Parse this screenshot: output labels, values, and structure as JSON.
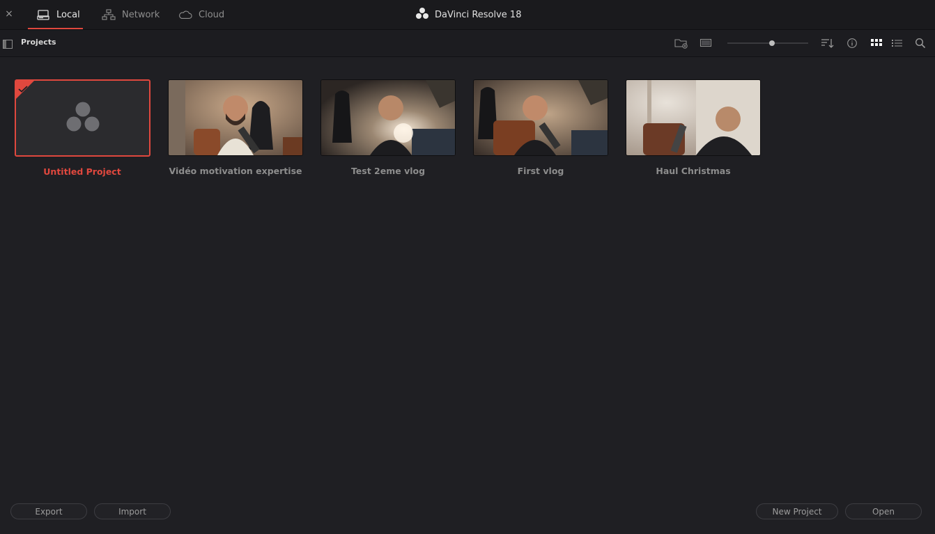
{
  "window": {
    "title": "DaVinci Resolve 18",
    "close_glyph": "×"
  },
  "tabs": [
    {
      "label": "Local",
      "icon": "local-drive-icon",
      "active": true
    },
    {
      "label": "Network",
      "icon": "network-icon",
      "active": false
    },
    {
      "label": "Cloud",
      "icon": "cloud-icon",
      "active": false
    }
  ],
  "toolbar": {
    "title": "Projects",
    "thumbnail_zoom": 0.55,
    "icons": [
      "panel-toggle-icon",
      "new-folder-icon",
      "monitor-icon",
      "sort-icon",
      "info-icon",
      "grid-view-icon",
      "list-view-icon",
      "search-icon"
    ]
  },
  "projects": [
    {
      "name": "Untitled Project",
      "selected": true
    },
    {
      "name": "Vidéo motivation expertise",
      "selected": false
    },
    {
      "name": "Test 2eme vlog",
      "selected": false
    },
    {
      "name": "First vlog",
      "selected": false
    },
    {
      "name": "Haul Christmas",
      "selected": false
    }
  ],
  "buttons": {
    "export": "Export",
    "import": "Import",
    "new_project": "New Project",
    "open": "Open"
  },
  "colors": {
    "accent": "#e0483e",
    "background": "#1f1f23"
  }
}
